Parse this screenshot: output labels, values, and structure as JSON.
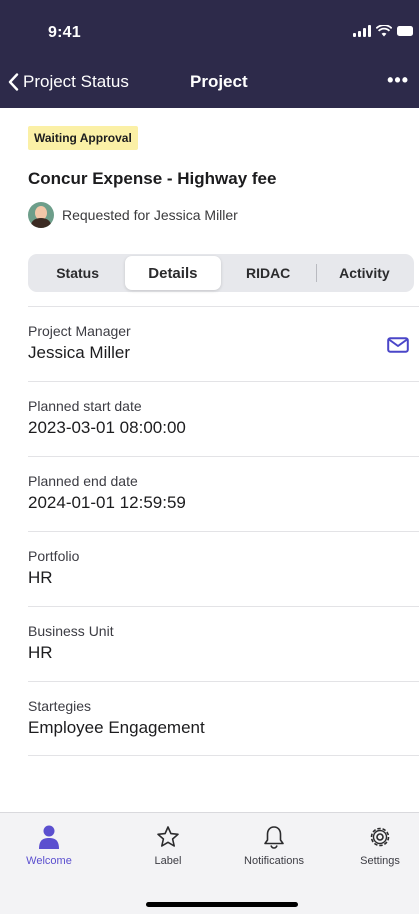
{
  "status_bar": {
    "time": "9:41"
  },
  "nav": {
    "back_label": "Project Status",
    "title": "Project",
    "more": "•••"
  },
  "project": {
    "status_badge": "Waiting Approval",
    "title": "Concur Expense - Highway fee",
    "requested_for": "Requested for Jessica Miller"
  },
  "tabs": [
    {
      "label": "Status",
      "active": false
    },
    {
      "label": "Details",
      "active": true
    },
    {
      "label": "RIDAC",
      "active": false
    },
    {
      "label": "Activity",
      "active": false
    }
  ],
  "fields": [
    {
      "label": "Project Manager",
      "value": "Jessica Miller"
    },
    {
      "label": "Planned start date",
      "value": "2023-03-01 08:00:00"
    },
    {
      "label": "Planned end date",
      "value": "2024-01-01 12:59:59"
    },
    {
      "label": "Portfolio",
      "value": "HR"
    },
    {
      "label": "Business Unit",
      "value": "HR"
    },
    {
      "label": "Startegies",
      "value": "Employee Engagement"
    }
  ],
  "tabbar": [
    {
      "label": "Welcome",
      "icon": "person-icon",
      "active": true
    },
    {
      "label": "Label",
      "icon": "star-icon",
      "active": false
    },
    {
      "label": "Notifications",
      "icon": "bell-icon",
      "active": false
    },
    {
      "label": "Settings",
      "icon": "gear-icon",
      "active": false
    }
  ],
  "colors": {
    "header_bg": "#2d2a4a",
    "accent": "#5b4fcf",
    "badge_bg": "#fbf0a6"
  }
}
